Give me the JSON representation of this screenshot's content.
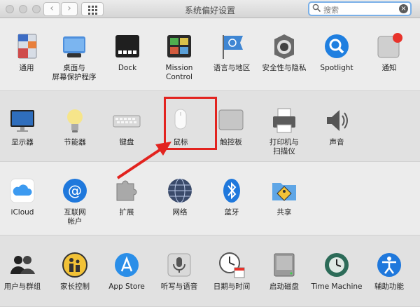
{
  "window": {
    "title": "系统偏好设置",
    "nav_back": "‹",
    "nav_forward": "›"
  },
  "search": {
    "placeholder": "搜索",
    "clear_glyph": "×"
  },
  "colors": {
    "highlight": "#e2231f",
    "search_focus": "#7ab0e8"
  },
  "rows": [
    {
      "items": [
        {
          "label": "通用",
          "icon": "general-icon"
        },
        {
          "label": "桌面与\n屏幕保护程序",
          "icon": "desktop-icon"
        },
        {
          "label": "Dock",
          "icon": "dock-icon"
        },
        {
          "label": "Mission\nControl",
          "icon": "mission-control-icon"
        },
        {
          "label": "语言与地区",
          "icon": "language-region-icon"
        },
        {
          "label": "安全性与隐私",
          "icon": "security-icon"
        },
        {
          "label": "Spotlight",
          "icon": "spotlight-icon"
        },
        {
          "label": "通知",
          "icon": "notifications-icon"
        }
      ]
    },
    {
      "items": [
        {
          "label": "显示器",
          "icon": "displays-icon"
        },
        {
          "label": "节能器",
          "icon": "energy-saver-icon"
        },
        {
          "label": "键盘",
          "icon": "keyboard-icon"
        },
        {
          "label": "鼠标",
          "icon": "mouse-icon"
        },
        {
          "label": "触控板",
          "icon": "trackpad-icon"
        },
        {
          "label": "打印机与\n扫描仪",
          "icon": "printer-icon"
        },
        {
          "label": "声音",
          "icon": "sound-icon"
        }
      ]
    },
    {
      "items": [
        {
          "label": "iCloud",
          "icon": "icloud-icon"
        },
        {
          "label": "互联网\n帐户",
          "icon": "internet-accounts-icon"
        },
        {
          "label": "扩展",
          "icon": "extensions-icon"
        },
        {
          "label": "网络",
          "icon": "network-icon"
        },
        {
          "label": "蓝牙",
          "icon": "bluetooth-icon"
        },
        {
          "label": "共享",
          "icon": "sharing-icon"
        }
      ]
    },
    {
      "items": [
        {
          "label": "用户与群组",
          "icon": "users-groups-icon"
        },
        {
          "label": "家长控制",
          "icon": "parental-controls-icon"
        },
        {
          "label": "App Store",
          "icon": "app-store-icon"
        },
        {
          "label": "听写与语音",
          "icon": "dictation-icon"
        },
        {
          "label": "日期与时间",
          "icon": "date-time-icon"
        },
        {
          "label": "启动磁盘",
          "icon": "startup-disk-icon"
        },
        {
          "label": "Time Machine",
          "icon": "time-machine-icon"
        },
        {
          "label": "辅助功能",
          "icon": "accessibility-icon"
        }
      ]
    }
  ]
}
